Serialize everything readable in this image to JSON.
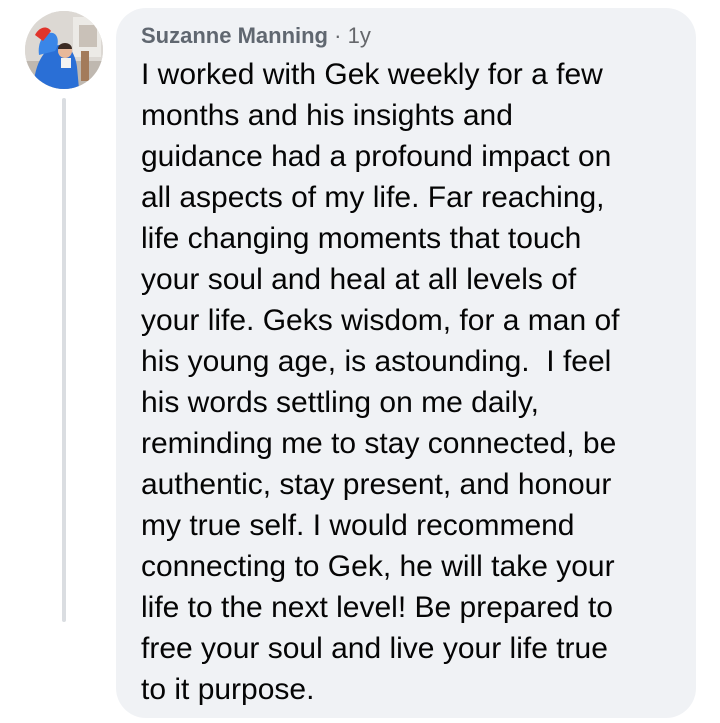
{
  "comment": {
    "author": "Suzanne Manning",
    "separator": "·",
    "time": "1y",
    "text": "I worked with Gek weekly for a few\nmonths and his insights and\nguidance had a profound impact on\nall aspects of my life. Far reaching,\nlife changing moments that touch\nyour soul and heal at all levels of\nyour life. Geks wisdom, for a man of\nhis young age, is astounding.  I feel\nhis words settling on me daily,\nreminding me to stay connected, be\nauthentic, stay present, and honour\nmy true self. I would recommend\nconnecting to Gek, he will take your\nlife to the next level! Be prepared to\nfree your soul and live your life true\nto it purpose."
  },
  "colors": {
    "bubble_background": "#f0f2f5",
    "author_text": "#606770",
    "body_text": "#050505",
    "thread_line": "#dadde1"
  }
}
